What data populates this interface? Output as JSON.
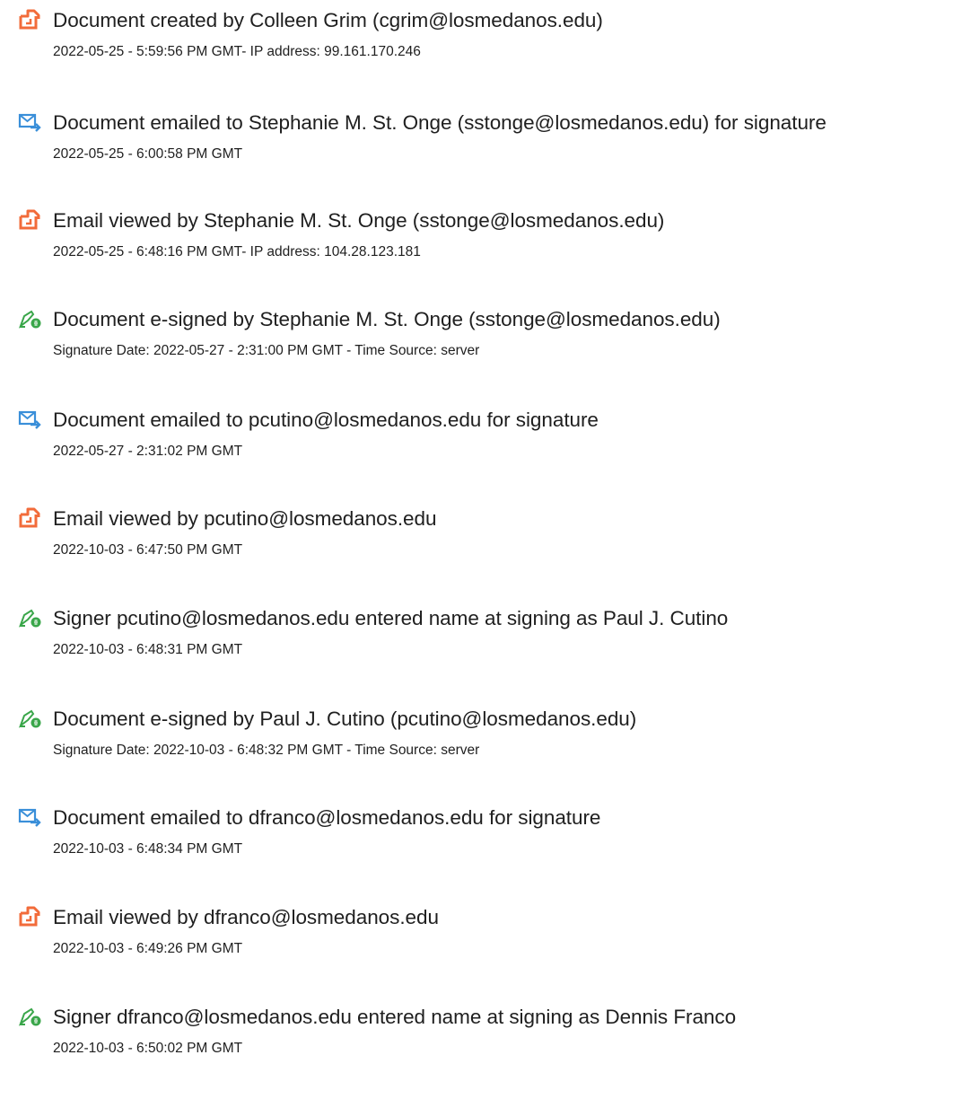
{
  "events": [
    {
      "icon": "document-viewed-icon",
      "title": "Document created by Colleen Grim (cgrim@losmedanos.edu)",
      "detail": "2022-05-25 - 5:59:56 PM GMT- IP address: 99.161.170.246"
    },
    {
      "icon": "email-sent-icon",
      "title": "Document emailed to Stephanie M. St. Onge (sstonge@losmedanos.edu) for signature",
      "detail": "2022-05-25 - 6:00:58 PM GMT"
    },
    {
      "icon": "document-viewed-icon",
      "title": "Email viewed by Stephanie M. St. Onge (sstonge@losmedanos.edu)",
      "detail": "2022-05-25 - 6:48:16 PM GMT- IP address: 104.28.123.181"
    },
    {
      "icon": "e-sign-pen-icon",
      "title": "Document e-signed by Stephanie M. St. Onge (sstonge@losmedanos.edu)",
      "detail": "Signature Date: 2022-05-27 - 2:31:00 PM GMT - Time Source: server"
    },
    {
      "icon": "email-sent-icon",
      "title": "Document emailed to pcutino@losmedanos.edu for signature",
      "detail": "2022-05-27 - 2:31:02 PM GMT"
    },
    {
      "icon": "document-viewed-icon",
      "title": "Email viewed by pcutino@losmedanos.edu",
      "detail": "2022-10-03 - 6:47:50 PM GMT"
    },
    {
      "icon": "e-sign-pen-icon",
      "title": "Signer pcutino@losmedanos.edu entered name at signing as Paul J. Cutino",
      "detail": "2022-10-03 - 6:48:31 PM GMT"
    },
    {
      "icon": "e-sign-pen-icon",
      "title": "Document e-signed by Paul J. Cutino (pcutino@losmedanos.edu)",
      "detail": "Signature Date: 2022-10-03 - 6:48:32 PM GMT - Time Source: server"
    },
    {
      "icon": "email-sent-icon",
      "title": "Document emailed to dfranco@losmedanos.edu for signature",
      "detail": "2022-10-03 - 6:48:34 PM GMT"
    },
    {
      "icon": "document-viewed-icon",
      "title": "Email viewed by dfranco@losmedanos.edu",
      "detail": "2022-10-03 - 6:49:26 PM GMT"
    },
    {
      "icon": "e-sign-pen-icon",
      "title": "Signer dfranco@losmedanos.edu entered name at signing as Dennis Franco",
      "detail": "2022-10-03 - 6:50:02 PM GMT"
    }
  ],
  "colors": {
    "document_icon": "#f26b3a",
    "email_icon": "#3a8fd9",
    "sign_icon": "#3aa64a"
  }
}
